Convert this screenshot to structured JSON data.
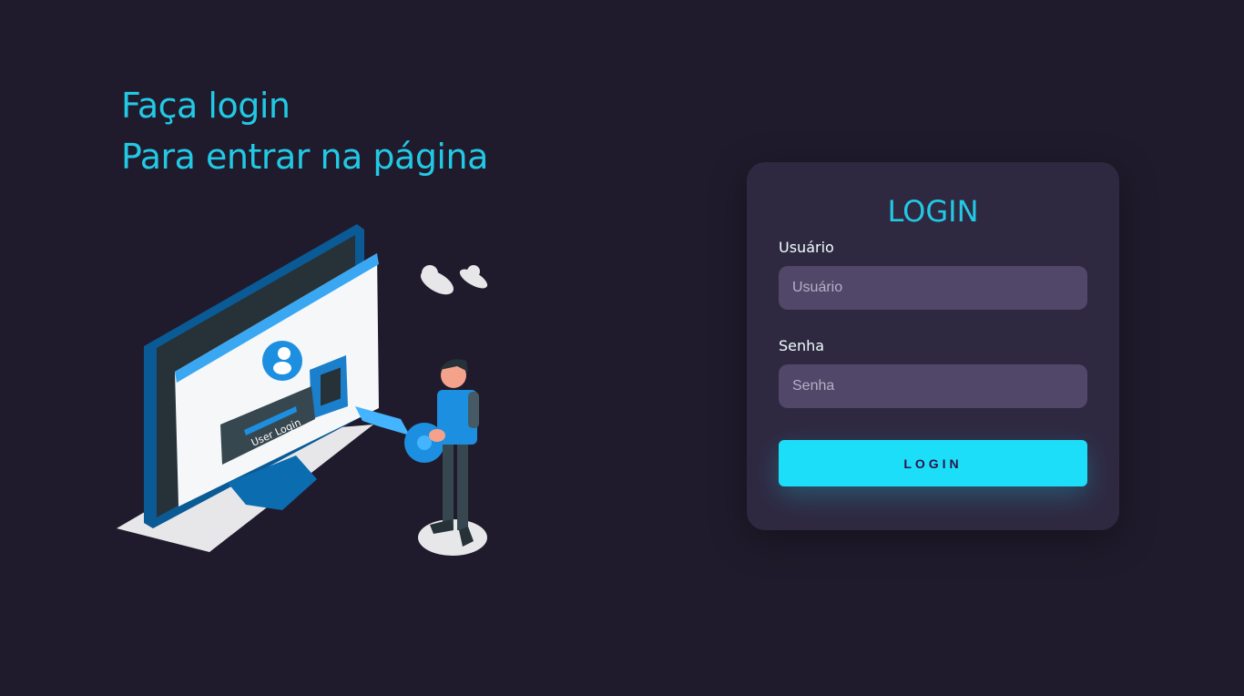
{
  "hero": {
    "line1": "Faça login",
    "line2": "Para entrar na página",
    "illustration_text": "User Login"
  },
  "login_card": {
    "title": "LOGIN",
    "username": {
      "label": "Usuário",
      "placeholder": "Usuário",
      "value": ""
    },
    "password": {
      "label": "Senha",
      "placeholder": "Senha",
      "value": ""
    },
    "submit_label": "LOGIN"
  },
  "colors": {
    "background": "#201b2c",
    "card": "#2f2841",
    "input": "#514869",
    "accent": "#22c9e5",
    "button": "#1ddef8"
  }
}
